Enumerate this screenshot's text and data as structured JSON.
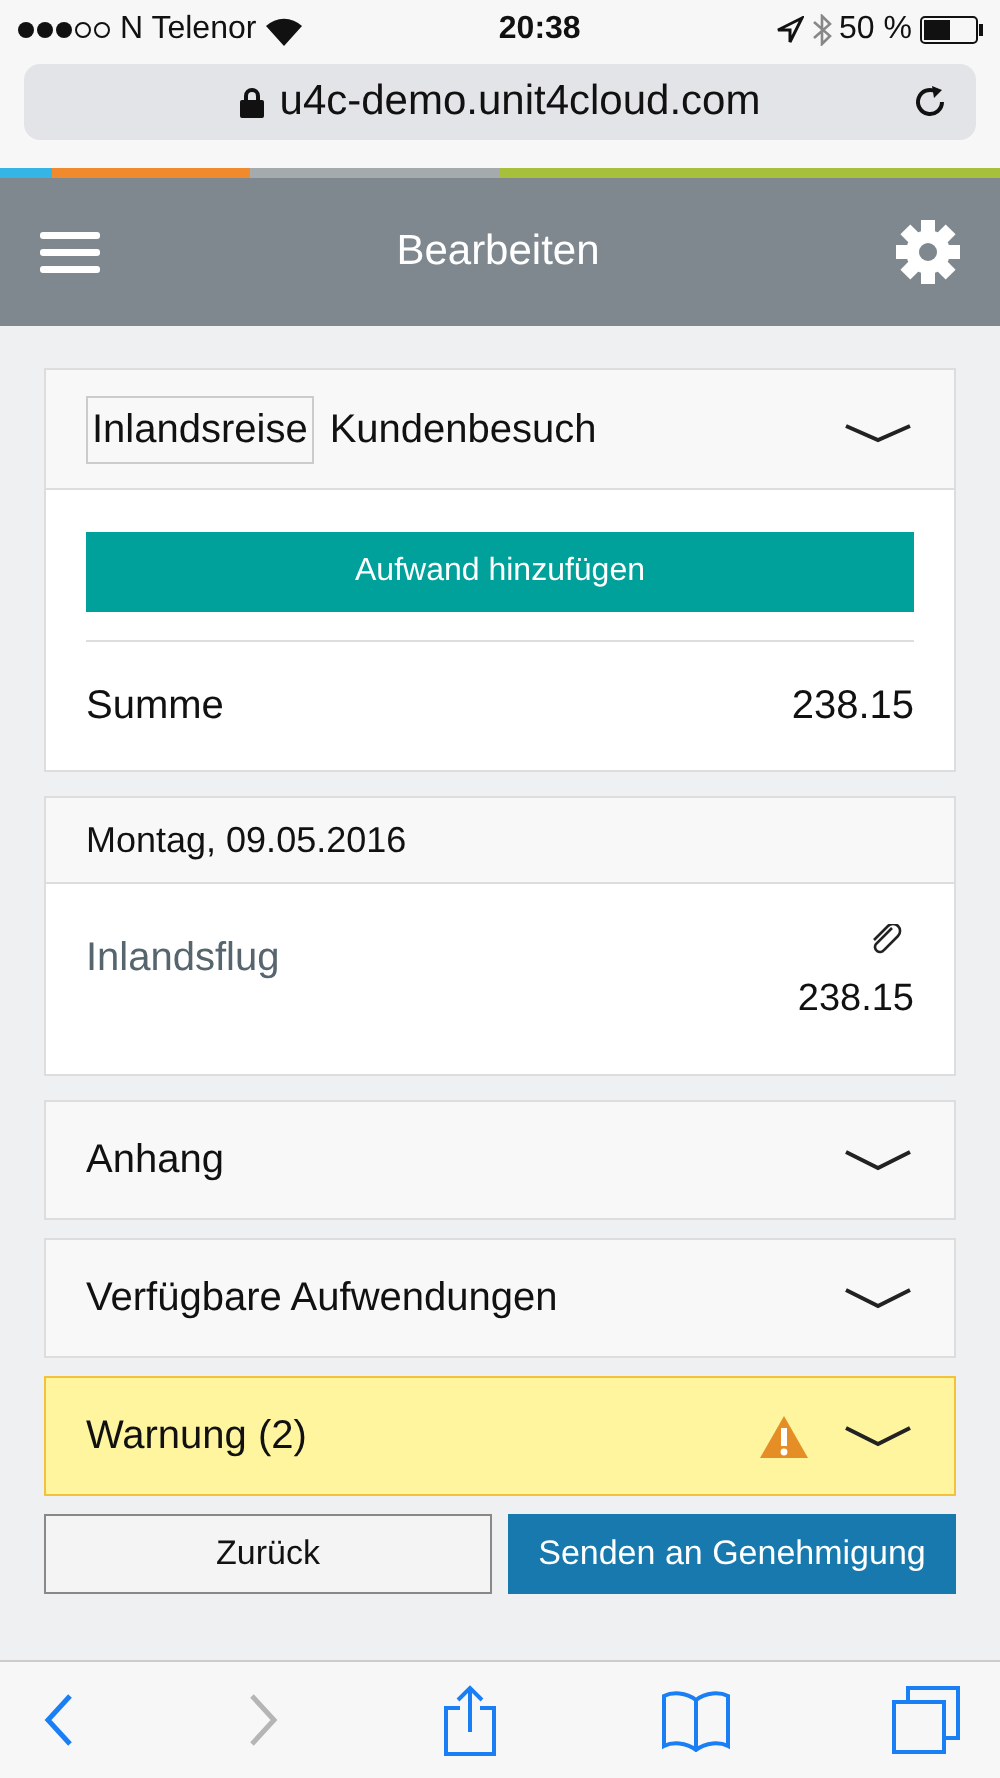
{
  "status_bar": {
    "carrier": "N Telenor",
    "time": "20:38",
    "battery": "50 %"
  },
  "address_bar": {
    "url": "u4c-demo.unit4cloud.com"
  },
  "header": {
    "title": "Bearbeiten"
  },
  "expense_card": {
    "tag": "Inlandsreise",
    "title": "Kundenbesuch",
    "expanded": true,
    "add_button": "Aufwand hinzufügen",
    "total_label": "Summe",
    "total_value": "238.15"
  },
  "day_card": {
    "date": "Montag, 09.05.2016",
    "items": [
      {
        "name": "Inlandsflug",
        "amount": "238.15",
        "attachment": true
      }
    ]
  },
  "sections": [
    {
      "kind": "normal",
      "label": "Anhang",
      "expanded": false
    },
    {
      "kind": "normal",
      "label": "Verfügbare Aufwendungen",
      "expanded": false
    },
    {
      "kind": "warning",
      "label": "Warnung (2)",
      "expanded": false
    }
  ],
  "buttons": [
    {
      "kind": "secondary",
      "label": "Zurück"
    },
    {
      "kind": "primary",
      "label": "Senden an Genehmigung"
    }
  ],
  "toolbar": [
    {
      "kind": "back",
      "disabled": false
    },
    {
      "kind": "forward",
      "disabled": true
    },
    {
      "kind": "share",
      "disabled": false
    },
    {
      "kind": "bookmarks",
      "disabled": false
    },
    {
      "kind": "tabs",
      "disabled": false
    }
  ]
}
